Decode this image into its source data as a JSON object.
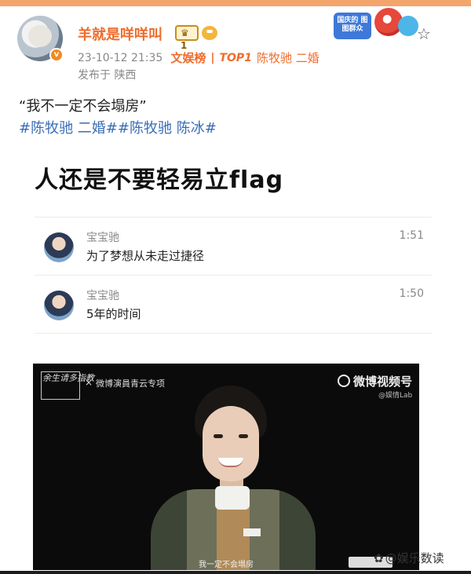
{
  "post": {
    "username": "羊就是咩咩叫",
    "vip_level": "1",
    "timestamp": "23-10-12 21:35",
    "channel_tag": "文娱榜",
    "rank_label": "TOP1",
    "rank_topic": "陈牧驰 二婚",
    "location": "发布于 陕西",
    "text": "“我不一定不会塌房”",
    "hashtags": "#陈牧驰 二婚##陈牧驰 陈冰#"
  },
  "header_badges": {
    "promo_text": "国庆的 图图群众"
  },
  "embedded": {
    "title": "人还是不要轻易立flag",
    "comments": [
      {
        "name": "宝宝驰",
        "text": "为了梦想从未走过捷径",
        "time": "1:51"
      },
      {
        "name": "宝宝驰",
        "text": "5年的时间",
        "time": "1:50"
      }
    ]
  },
  "video": {
    "brush_title": "余生请多指教",
    "cross": "×",
    "collab": "微博演員青云专项",
    "platform_logo": "微博视频号",
    "platform_sub": "@娱情Lab",
    "subtitle": "我一定不会塌房"
  },
  "watermark": "@娱乐数读",
  "colors": {
    "accent_orange": "#ef6c2b",
    "hashtag_blue": "#3a6db5"
  }
}
